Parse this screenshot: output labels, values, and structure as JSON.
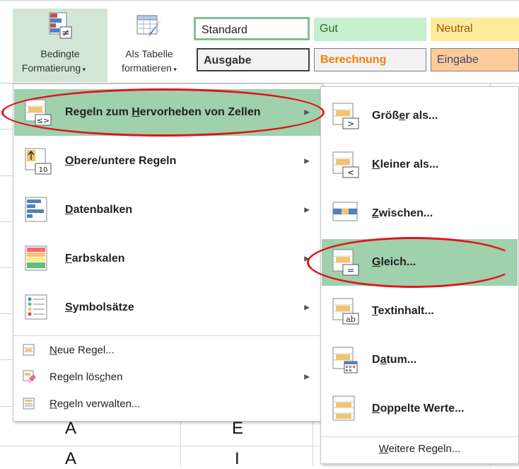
{
  "ribbon": {
    "conditional_formatting": {
      "line1": "Bedingte",
      "line2": "Formatierung"
    },
    "format_as_table": {
      "line1": "Als Tabelle",
      "line2": "formatieren"
    },
    "styles": [
      {
        "label": "Standard",
        "bg": "#ffffff",
        "color": "#222222",
        "border": "#6fb07a",
        "bold": false
      },
      {
        "label": "Gut",
        "bg": "#c6efce",
        "color": "#2a6a2a",
        "border": "#c6efce",
        "bold": false
      },
      {
        "label": "Neutral",
        "bg": "#ffeb9c",
        "color": "#9c5700",
        "border": "#ffeb9c",
        "bold": false
      },
      {
        "label": "Ausgabe",
        "bg": "#f2f2f2",
        "color": "#333333",
        "border": "#3f3f3f",
        "bold": true
      },
      {
        "label": "Berechnung",
        "bg": "#f2f2f2",
        "color": "#fa7d00",
        "border": "#7f7f7f",
        "bold": true
      },
      {
        "label": "Eingabe",
        "bg": "#ffcc99",
        "color": "#3f3f76",
        "border": "#7f7f7f",
        "bold": false
      }
    ]
  },
  "cells": [
    "A",
    "E",
    "A",
    "I"
  ],
  "main_menu": {
    "items": [
      {
        "pre": "Regeln zum ",
        "u": "H",
        "post": "ervorheben von Zellen",
        "icon": "highlight-cells-rules-icon",
        "arrow": "▶"
      },
      {
        "pre": "",
        "u": "O",
        "post": "bere/untere Regeln",
        "icon": "top-bottom-rules-icon",
        "arrow": "▶"
      },
      {
        "pre": "",
        "u": "D",
        "post": "atenbalken",
        "icon": "data-bars-icon",
        "arrow": "▶"
      },
      {
        "pre": "",
        "u": "F",
        "post": "arbskalen",
        "icon": "color-scales-icon",
        "arrow": "▶"
      },
      {
        "pre": "",
        "u": "S",
        "post": "ymbolsätze",
        "icon": "icon-sets-icon",
        "arrow": "▶"
      }
    ],
    "small_items": [
      {
        "pre": "",
        "u": "N",
        "post": "eue Regel...",
        "icon": "new-rule-icon",
        "arrow": ""
      },
      {
        "pre": "Regeln lös",
        "u": "c",
        "post": "hen",
        "icon": "clear-rules-icon",
        "arrow": "▶"
      },
      {
        "pre": "",
        "u": "R",
        "post": "egeln verwalten...",
        "icon": "manage-rules-icon",
        "arrow": ""
      }
    ]
  },
  "submenu": {
    "items": [
      {
        "pre": "Größ",
        "u": "e",
        "post": "r als...",
        "icon": "greater-than-icon"
      },
      {
        "pre": "",
        "u": "K",
        "post": "leiner als...",
        "icon": "less-than-icon"
      },
      {
        "pre": "",
        "u": "Z",
        "post": "wischen...",
        "icon": "between-icon"
      },
      {
        "pre": "",
        "u": "G",
        "post": "leich...",
        "icon": "equal-to-icon"
      },
      {
        "pre": "",
        "u": "T",
        "post": "extinhalt...",
        "icon": "text-contains-icon"
      },
      {
        "pre": "D",
        "u": "a",
        "post": "tum...",
        "icon": "date-occurring-icon"
      },
      {
        "pre": "",
        "u": "D",
        "post": "oppelte Werte...",
        "icon": "duplicate-values-icon"
      }
    ],
    "footer": {
      "pre": "",
      "u": "W",
      "post": "eitere Regeln..."
    }
  }
}
